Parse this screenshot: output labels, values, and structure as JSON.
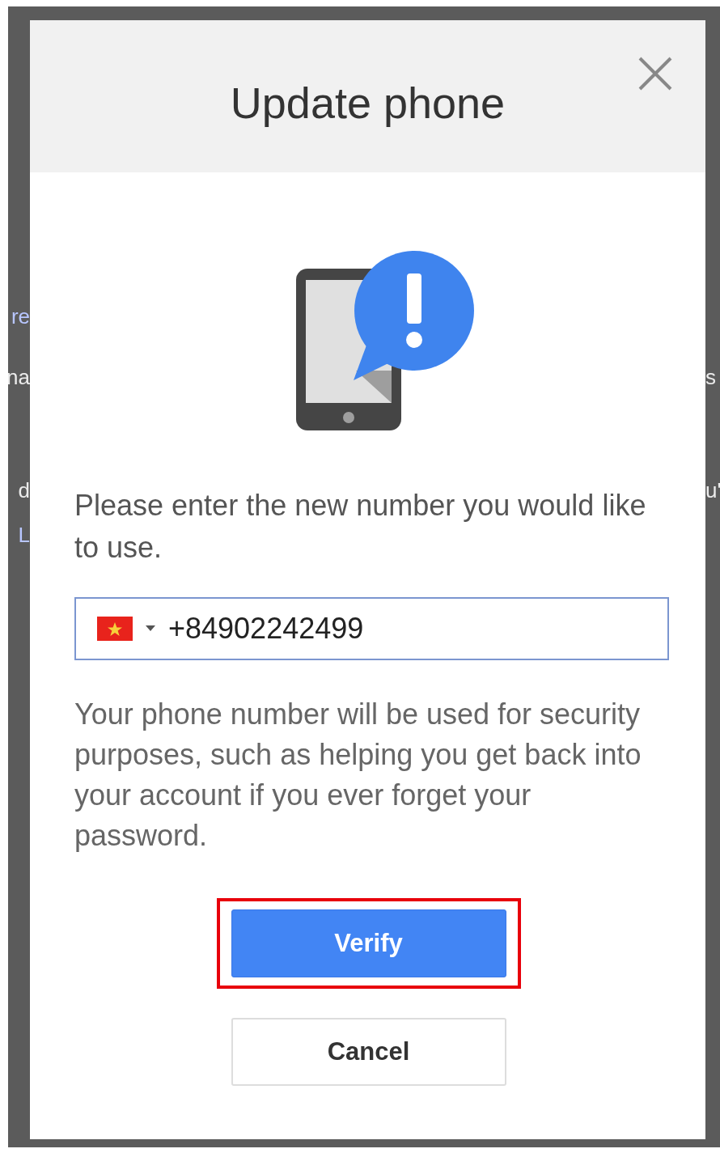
{
  "background_fragments": {
    "left": [
      {
        "text": "re",
        "kind": "link"
      },
      {
        "text": "na",
        "kind": "text"
      },
      {
        "text": "d",
        "kind": "text"
      },
      {
        "text": "L",
        "kind": "link"
      }
    ],
    "right": [
      {
        "text": "s"
      },
      {
        "text": "u'"
      }
    ]
  },
  "dialog": {
    "title": "Update phone",
    "prompt": "Please enter the new number you would like to use.",
    "phone_field": {
      "value": "+84902242499"
    },
    "note": "Your phone number will be used for security purposes, such as helping you get back into your account if you ever forget your password.",
    "buttons": [
      {
        "label": "Verify",
        "kind": "primary",
        "highlighted": true
      },
      {
        "label": "Cancel",
        "kind": "secondary",
        "highlighted": false
      }
    ]
  }
}
